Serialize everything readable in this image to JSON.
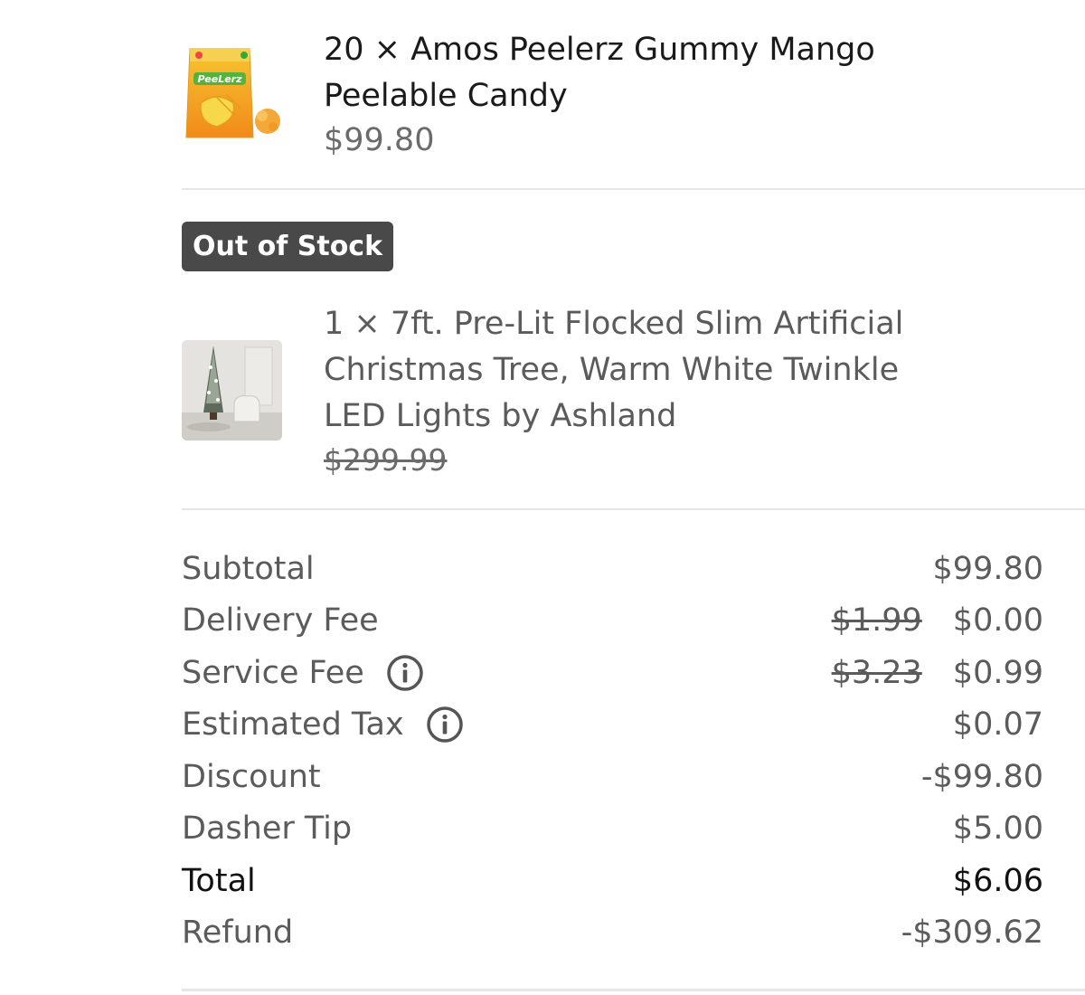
{
  "items": [
    {
      "quantity_name": "20 × Amos Peelerz Gummy Mango Peelable Candy",
      "name_line1": "20 × Amos Peelerz Gummy Mango",
      "name_line2": "Peelable Candy",
      "price": "$99.80",
      "thumbnail_brand": "PeeLerz",
      "status": ""
    },
    {
      "status": "Out of Stock",
      "name_line1": "1 × 7ft. Pre-Lit Flocked Slim Artificial",
      "name_line2": "Christmas Tree, Warm White Twinkle",
      "name_line3": "LED Lights by Ashland",
      "price": "$299.99"
    }
  ],
  "summary": {
    "subtotal": {
      "label": "Subtotal",
      "value": "$99.80"
    },
    "delivery_fee": {
      "label": "Delivery Fee",
      "original": "$1.99",
      "value": "$0.00"
    },
    "service_fee": {
      "label": "Service Fee",
      "original": "$3.23",
      "value": "$0.99",
      "icon": "info-icon"
    },
    "estimated_tax": {
      "label": "Estimated Tax",
      "value": "$0.07",
      "icon": "info-icon"
    },
    "discount": {
      "label": "Discount",
      "value": "-$99.80"
    },
    "dasher_tip": {
      "label": "Dasher Tip",
      "value": "$5.00"
    },
    "total": {
      "label": "Total",
      "value": "$6.06"
    },
    "refund": {
      "label": "Refund",
      "value": "-$309.62"
    }
  },
  "colors": {
    "badge_bg": "#494949",
    "text_primary": "#1a1a1a",
    "text_secondary": "#5b5b5b",
    "divider": "#e6e6e6"
  }
}
